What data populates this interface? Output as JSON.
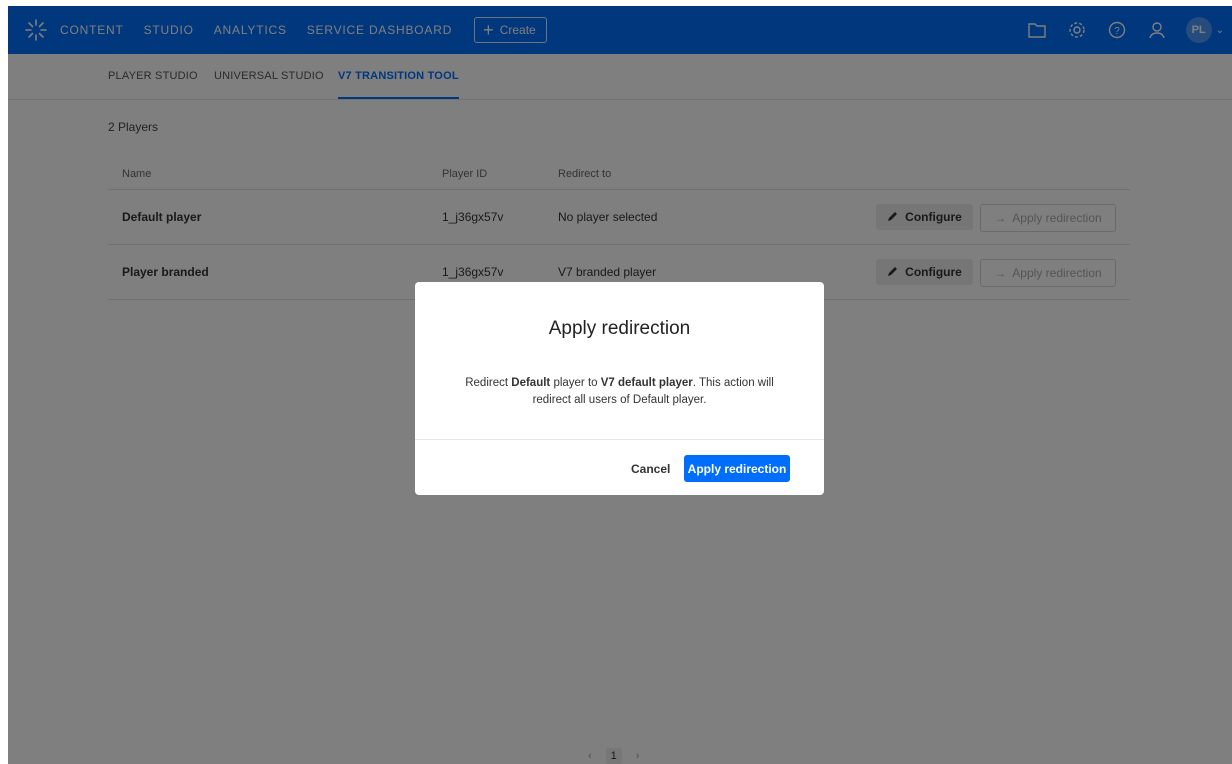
{
  "topnav": {
    "logo_icon": "kaltura-logo-icon",
    "items": [
      {
        "label": "CONTENT"
      },
      {
        "label": "STUDIO"
      },
      {
        "label": "ANALYTICS"
      },
      {
        "label": "SERVICE DASHBOARD"
      }
    ],
    "create_label": "Create",
    "icons": [
      "folder-icon",
      "gear-icon",
      "help-icon",
      "user-icon"
    ],
    "avatar_initials": "PL"
  },
  "subtabs": [
    {
      "label": "PLAYER STUDIO",
      "active": false
    },
    {
      "label": "UNIVERSAL STUDIO",
      "active": false
    },
    {
      "label": "V7 TRANSITION TOOL",
      "active": true
    }
  ],
  "players_count": "2 Players",
  "table": {
    "headers": {
      "name": "Name",
      "player_id": "Player ID",
      "redirect": "Redirect to"
    },
    "rows": [
      {
        "name": "Default player",
        "player_id": "1_j36gx57v",
        "redirect": "No player selected",
        "configure": "Configure",
        "apply": "Apply redirection"
      },
      {
        "name": "Player branded",
        "player_id": "1_j36gx57v",
        "redirect": "V7 branded player",
        "configure": "Configure",
        "apply": "Apply redirection"
      }
    ]
  },
  "pagination": {
    "prev": "‹",
    "current": "1",
    "next": "›"
  },
  "modal": {
    "title": "Apply redirection",
    "body_pre": "Redirect ",
    "body_source": "Default",
    "body_mid": " player to ",
    "body_target": "V7 default player",
    "body_post": ". This action will redirect all users of Default player.",
    "cancel_label": "Cancel",
    "apply_label": "Apply redirection"
  },
  "colors": {
    "brand": "#006efa",
    "overlay": "rgba(0,0,0,0.5)"
  }
}
